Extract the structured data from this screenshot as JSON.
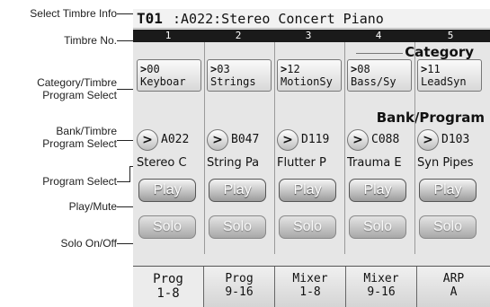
{
  "callouts": {
    "select_timbre_info": "Select Timbre Info",
    "timbre_no": "Timbre No.",
    "category_select_line1": "Category/Timbre",
    "category_select_line2": "Program Select",
    "bank_select_line1": "Bank/Timbre",
    "bank_select_line2": "Program Select",
    "program_select": "Program Select",
    "play_mute": "Play/Mute",
    "solo_on_off": "Solo On/Off"
  },
  "screen": {
    "title_id": "T01",
    "title_text": ":A022:Stereo Concert Piano",
    "sections": {
      "category": "Category",
      "bank_program": "Bank/Program"
    },
    "timbres": [
      {
        "num": "1",
        "cat_arrow": ">",
        "cat_id": "00",
        "cat_name": "Keyboar",
        "bank_arrow": ">",
        "bank": "A022",
        "program": "Stereo C",
        "play": "Play",
        "solo": "Solo"
      },
      {
        "num": "2",
        "cat_arrow": ">",
        "cat_id": "03",
        "cat_name": "Strings",
        "bank_arrow": ">",
        "bank": "B047",
        "program": "String Pa",
        "play": "Play",
        "solo": "Solo"
      },
      {
        "num": "3",
        "cat_arrow": ">",
        "cat_id": "12",
        "cat_name": "MotionSy",
        "bank_arrow": ">",
        "bank": "D119",
        "program": "Flutter P",
        "play": "Play",
        "solo": "Solo"
      },
      {
        "num": "4",
        "cat_arrow": ">",
        "cat_id": "08",
        "cat_name": "Bass/Sy",
        "bank_arrow": ">",
        "bank": "C088",
        "program": "Trauma E",
        "play": "Play",
        "solo": "Solo"
      },
      {
        "num": "5",
        "cat_arrow": ">",
        "cat_id": "11",
        "cat_name": "LeadSyn",
        "bank_arrow": ">",
        "bank": "D103",
        "program": "Syn Pipes",
        "play": "Play",
        "solo": "Solo"
      }
    ],
    "tabs": [
      {
        "line1": "Prog",
        "line2": "1-8"
      },
      {
        "line1": "Prog",
        "line2": "9-16"
      },
      {
        "line1": "Mixer",
        "line2": "1-8"
      },
      {
        "line1": "Mixer",
        "line2": "9-16"
      },
      {
        "line1": "ARP",
        "line2": "A"
      }
    ]
  }
}
